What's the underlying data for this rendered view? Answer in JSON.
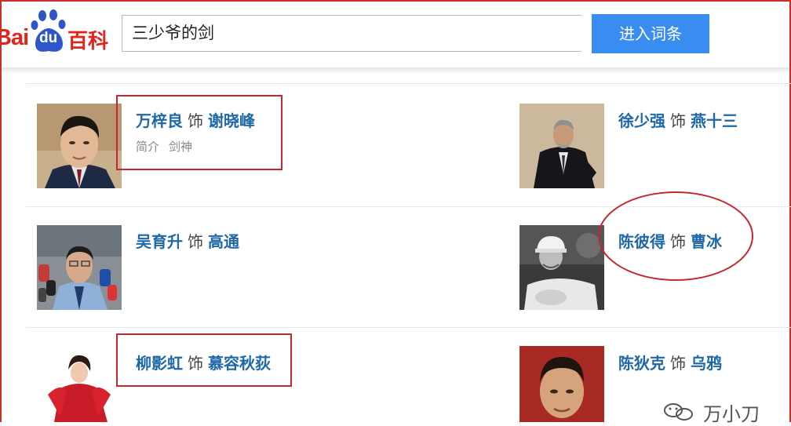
{
  "logo": {
    "bai": "Bai",
    "du": "du",
    "baike": "百科"
  },
  "search": {
    "value": "三少爷的剑",
    "button_label": "进入词条"
  },
  "cast": [
    {
      "actor": "万梓良",
      "sep": "饰",
      "role": "谢晓峰",
      "desc": [
        "简介",
        "剑神"
      ]
    },
    {
      "actor": "徐少强",
      "sep": "饰",
      "role": "燕十三",
      "desc": []
    },
    {
      "actor": "吴育升",
      "sep": "饰",
      "role": "高通",
      "desc": []
    },
    {
      "actor": "陈彼得",
      "sep": "饰",
      "role": "曹冰",
      "desc": []
    },
    {
      "actor": "柳影虹",
      "sep": "饰",
      "role": "慕容秋荻",
      "desc": []
    },
    {
      "actor": "陈狄克",
      "sep": "饰",
      "role": "乌鸦",
      "desc": []
    }
  ],
  "watermark": {
    "text": "万小刀",
    "icon": "wechat-icon"
  },
  "colors": {
    "brand_red": "#e1251b",
    "link_blue": "#1f68a8",
    "button_blue": "#3a8df0",
    "annotation_red": "#c6262c"
  }
}
